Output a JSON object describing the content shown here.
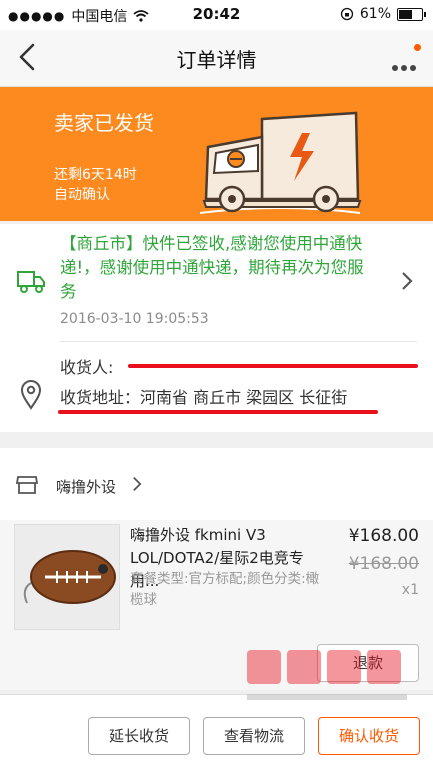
{
  "status_bar": {
    "signal_dots": "●●●●●",
    "carrier": "中国电信",
    "time": "20:42",
    "battery_percent": "61%",
    "battery_level": 0.61
  },
  "nav": {
    "title": "订单详情"
  },
  "banner": {
    "status": "卖家已发货",
    "remaining": "还剩6天14时",
    "auto_confirm": "自动确认"
  },
  "logistics": {
    "message": "【商丘市】快件已签收,感谢您使用中通快递!，感谢使用中通快递，期待再次为您服务",
    "time": "2016-03-10 19:05:53"
  },
  "address": {
    "receiver_label": "收货人:",
    "address_text": "收货地址：河南省 商丘市 梁园区 长征街"
  },
  "shop": {
    "name": "嗨撸外设"
  },
  "item": {
    "title": "嗨撸外设 fkmini V3 LOL/DOTA2/星际2电竞专用...",
    "sku": "套餐类型:官方标配;颜色分类:橄榄球",
    "price": "¥168.00",
    "original_price": "¥168.00",
    "quantity": "x1",
    "refund_label": "退款"
  },
  "actions": {
    "extend_label": "延长收货",
    "logistics_label": "查看物流",
    "confirm_label": "确认收货"
  },
  "colors": {
    "accent": "#fd8a1f",
    "logistics_green": "#30a53b",
    "redaction": "#e8101d"
  }
}
